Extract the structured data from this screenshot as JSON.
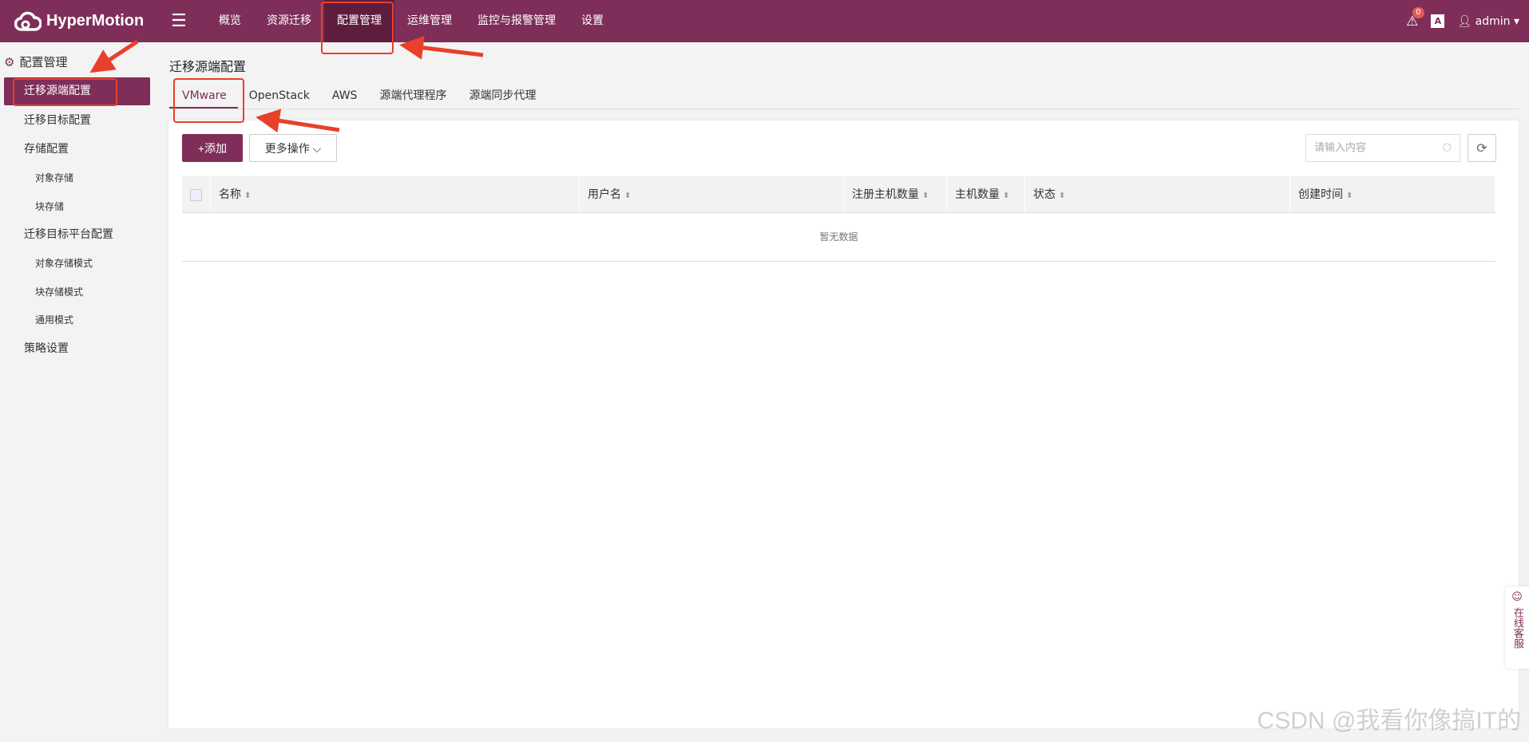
{
  "header": {
    "brand": "HyperMotion",
    "nav": [
      {
        "label": "概览"
      },
      {
        "label": "资源迁移"
      },
      {
        "label": "配置管理"
      },
      {
        "label": "运维管理"
      },
      {
        "label": "监控与报警管理"
      },
      {
        "label": "设置"
      }
    ],
    "alert_count": "0",
    "lang_label": "A",
    "user": "admin"
  },
  "sidebar": {
    "title": "配置管理",
    "items": [
      {
        "label": "迁移源端配置"
      },
      {
        "label": "迁移目标配置"
      },
      {
        "label": "存储配置"
      },
      {
        "label": "对象存储"
      },
      {
        "label": "块存储"
      },
      {
        "label": "迁移目标平台配置"
      },
      {
        "label": "对象存储模式"
      },
      {
        "label": "块存储模式"
      },
      {
        "label": "通用模式"
      },
      {
        "label": "策略设置"
      }
    ]
  },
  "main": {
    "title": "迁移源端配置",
    "tabs": [
      {
        "label": "VMware"
      },
      {
        "label": "OpenStack"
      },
      {
        "label": "AWS"
      },
      {
        "label": "源端代理程序"
      },
      {
        "label": "源端同步代理"
      }
    ],
    "add_label": "+添加",
    "more_label": "更多操作 ⌵",
    "search_placeholder": "请输入内容",
    "columns": [
      {
        "label": "名称"
      },
      {
        "label": "用户名"
      },
      {
        "label": "注册主机数量"
      },
      {
        "label": "主机数量"
      },
      {
        "label": "状态"
      },
      {
        "label": "创建时间"
      }
    ],
    "empty_text": "暂无数据"
  },
  "service": {
    "label": "在线客服"
  },
  "watermark": "CSDN @我看你像搞IT的",
  "colors": {
    "brand": "#7e2e58",
    "annotation": "#e8402a"
  }
}
